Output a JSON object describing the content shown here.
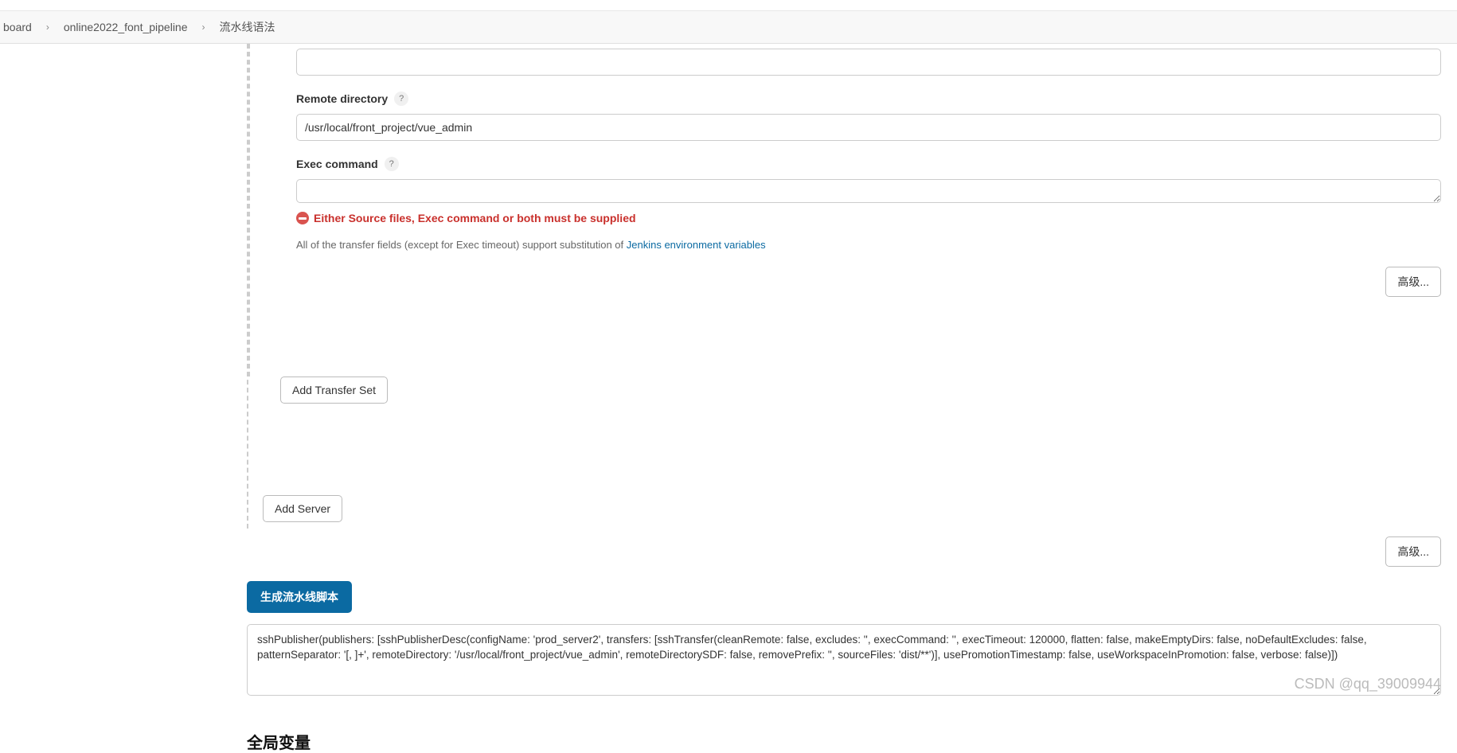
{
  "breadcrumb": {
    "item1": "board",
    "item2": "online2022_font_pipeline",
    "item3": "流水线语法"
  },
  "form": {
    "remoteDirectory": {
      "label": "Remote directory",
      "value": "/usr/local/front_project/vue_admin"
    },
    "execCommand": {
      "label": "Exec command",
      "value": ""
    },
    "errorMessage": "Either Source files, Exec command or both must be supplied",
    "hintPrefix": "All of the transfer fields (except for Exec timeout) support substitution of ",
    "hintLink": "Jenkins environment variables",
    "advancedLabel": "高级...",
    "addTransferSet": "Add Transfer Set",
    "addServer": "Add Server",
    "generateScript": "生成流水线脚本",
    "scriptOutput": "sshPublisher(publishers: [sshPublisherDesc(configName: 'prod_server2', transfers: [sshTransfer(cleanRemote: false, excludes: '', execCommand: '', execTimeout: 120000, flatten: false, makeEmptyDirs: false, noDefaultExcludes: false, patternSeparator: '[, ]+', remoteDirectory: '/usr/local/front_project/vue_admin', remoteDirectorySDF: false, removePrefix: '', sourceFiles: 'dist/**')], usePromotionTimestamp: false, useWorkspaceInPromotion: false, verbose: false)])"
  },
  "section": {
    "globalVars": "全局变量"
  },
  "watermark": "CSDN @qq_39009944"
}
